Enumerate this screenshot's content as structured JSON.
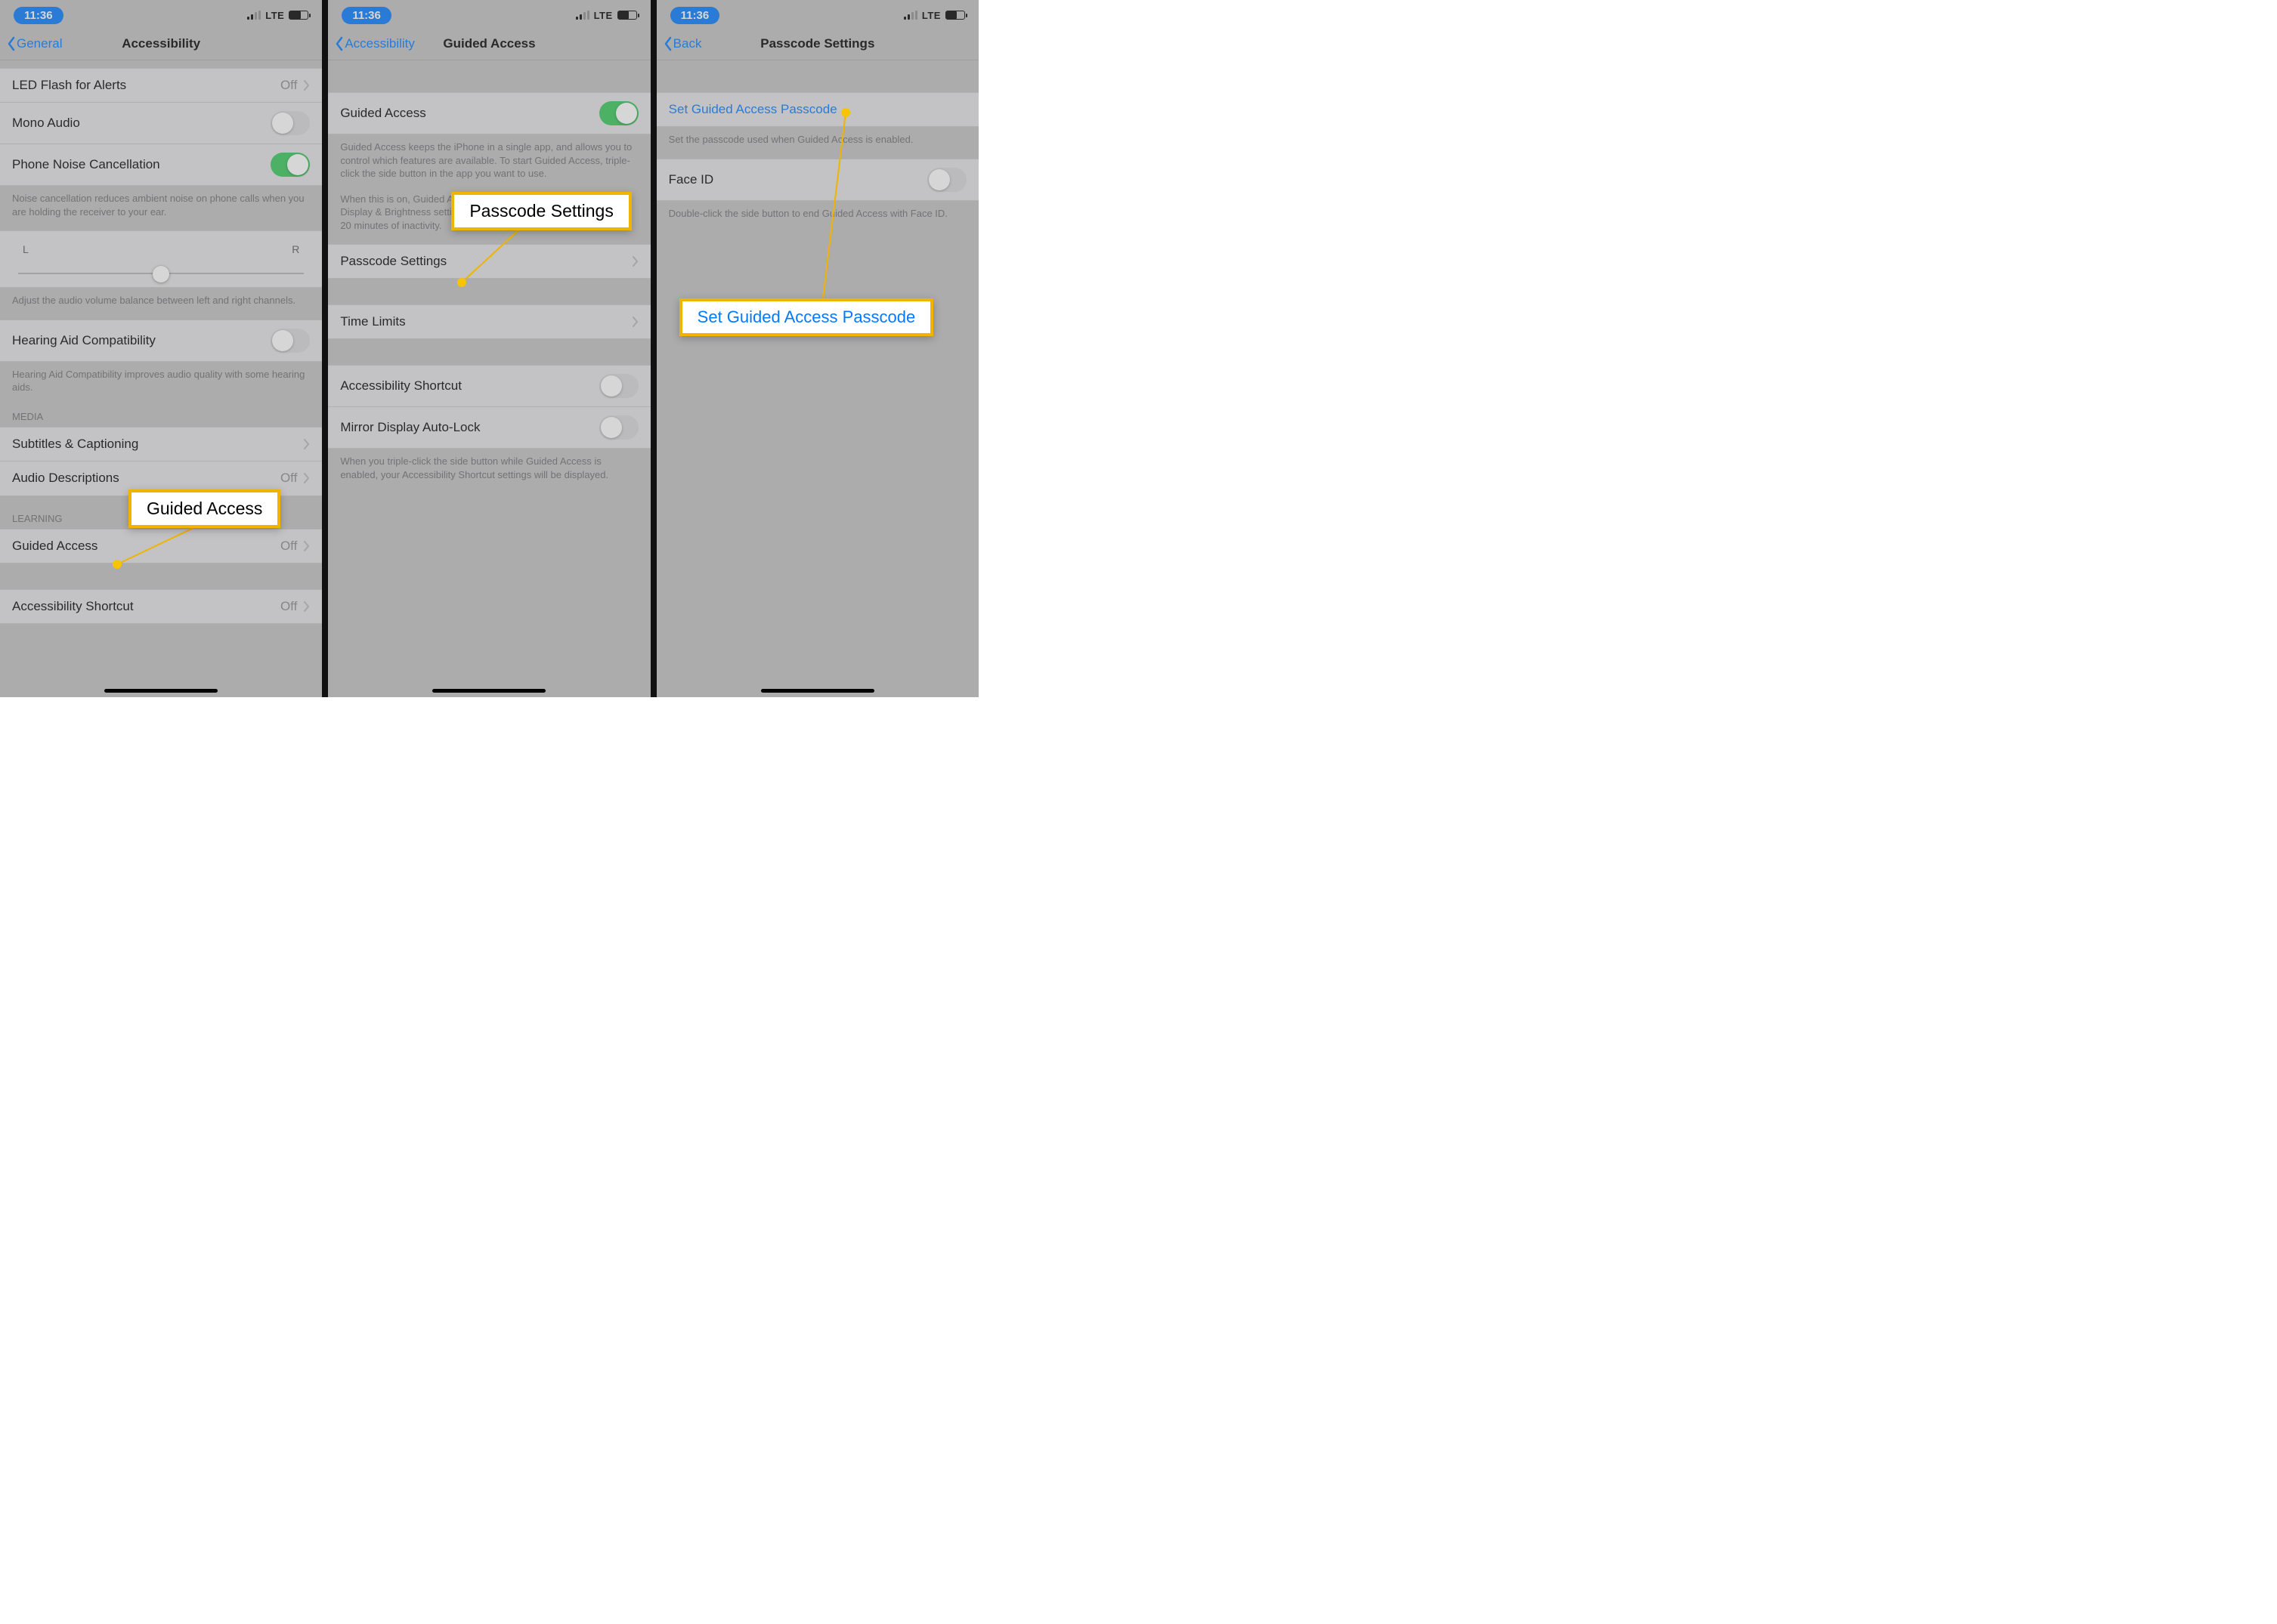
{
  "status": {
    "time": "11:36",
    "network": "LTE"
  },
  "screen1": {
    "back": "General",
    "title": "Accessibility",
    "rows": {
      "led": {
        "label": "LED Flash for Alerts",
        "value": "Off"
      },
      "mono": {
        "label": "Mono Audio"
      },
      "noise": {
        "label": "Phone Noise Cancellation"
      },
      "noise_footer": "Noise cancellation reduces ambient noise on phone calls when you are holding the receiver to your ear.",
      "slider": {
        "left": "L",
        "right": "R"
      },
      "slider_footer": "Adjust the audio volume balance between left and right channels.",
      "hearing": {
        "label": "Hearing Aid Compatibility"
      },
      "hearing_footer": "Hearing Aid Compatibility improves audio quality with some hearing aids.",
      "media_header": "MEDIA",
      "subtitles": {
        "label": "Subtitles & Captioning"
      },
      "audio_desc": {
        "label": "Audio Descriptions",
        "value": "Off"
      },
      "learning_header": "LEARNING",
      "guided": {
        "label": "Guided Access",
        "value": "Off"
      },
      "shortcut": {
        "label": "Accessibility Shortcut",
        "value": "Off"
      }
    },
    "callout": "Guided Access"
  },
  "screen2": {
    "back": "Accessibility",
    "title": "Guided Access",
    "rows": {
      "ga": {
        "label": "Guided Access"
      },
      "ga_footer1": "Guided Access keeps the iPhone in a single app, and allows you to control which features are available. To start Guided Access, triple-click the side button in the app you want to use.",
      "ga_footer2": "When this is on, Guided Access overrides the Auto-Lock setting in Display & Brightness settings, and will only turn off the screen after 20 minutes of inactivity.",
      "passcode": {
        "label": "Passcode Settings"
      },
      "time_limits": {
        "label": "Time Limits"
      },
      "shortcut": {
        "label": "Accessibility Shortcut"
      },
      "mirror": {
        "label": "Mirror Display Auto-Lock"
      },
      "mirror_footer": "When you triple-click the side button while Guided Access is enabled, your Accessibility Shortcut settings will be displayed."
    },
    "callout": "Passcode Settings"
  },
  "screen3": {
    "back": "Back",
    "title": "Passcode Settings",
    "rows": {
      "set": {
        "label": "Set Guided Access Passcode"
      },
      "set_footer": "Set the passcode used when Guided Access is enabled.",
      "faceid": {
        "label": "Face ID"
      },
      "faceid_footer": "Double-click the side button to end Guided Access with Face ID."
    },
    "callout": "Set Guided Access Passcode"
  }
}
